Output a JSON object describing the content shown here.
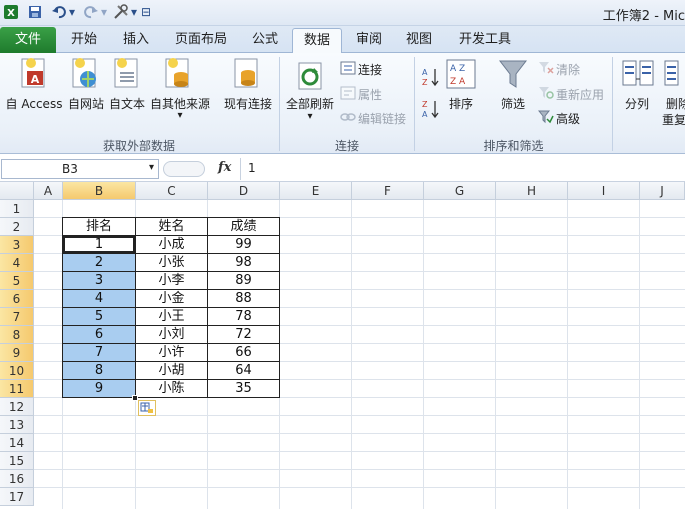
{
  "window": {
    "title": "工作簿2 - Mic"
  },
  "quick_access": {
    "dropdown_glyph": "▾",
    "customize_glyph": "⊟"
  },
  "tabs": [
    {
      "label": "文件",
      "kind": "file"
    },
    {
      "label": "开始"
    },
    {
      "label": "插入"
    },
    {
      "label": "页面布局"
    },
    {
      "label": "公式"
    },
    {
      "label": "数据",
      "active": true
    },
    {
      "label": "审阅"
    },
    {
      "label": "视图"
    },
    {
      "label": "开发工具"
    }
  ],
  "ribbon": {
    "groups": [
      {
        "name": "获取外部数据",
        "buttons": [
          "自 Access",
          "自网站",
          "自文本",
          "自其他来源",
          "现有连接"
        ]
      },
      {
        "name": "连接",
        "buttons": [
          "全部刷新",
          "连接",
          "属性",
          "编辑链接"
        ]
      },
      {
        "name": "排序和筛选",
        "buttons": [
          "排序",
          "筛选",
          "清除",
          "重新应用",
          "高级"
        ]
      },
      {
        "name": "",
        "buttons": [
          "分列",
          "删除",
          "重复"
        ]
      }
    ],
    "dropdown_glyph": "▾"
  },
  "formula_bar": {
    "name_box": "B3",
    "fx": "fx",
    "value": "1"
  },
  "columns": [
    "A",
    "B",
    "C",
    "D",
    "E",
    "F",
    "G",
    "H",
    "I",
    "J"
  ],
  "rows": [
    "1",
    "2",
    "3",
    "4",
    "5",
    "6",
    "7",
    "8",
    "9",
    "10",
    "11",
    "12",
    "13",
    "14",
    "15",
    "16",
    "17"
  ],
  "table": {
    "headers": [
      "排名",
      "姓名",
      "成绩"
    ],
    "rows": [
      [
        "1",
        "小成",
        "99"
      ],
      [
        "2",
        "小张",
        "98"
      ],
      [
        "3",
        "小李",
        "89"
      ],
      [
        "4",
        "小金",
        "88"
      ],
      [
        "5",
        "小王",
        "78"
      ],
      [
        "6",
        "小刘",
        "72"
      ],
      [
        "7",
        "小许",
        "66"
      ],
      [
        "8",
        "小胡",
        "64"
      ],
      [
        "9",
        "小陈",
        "35"
      ]
    ]
  },
  "colors": {
    "file_tab": "#2a8c3a",
    "selection": "#a9cdf0",
    "header_highlight": "#f5c96e"
  }
}
